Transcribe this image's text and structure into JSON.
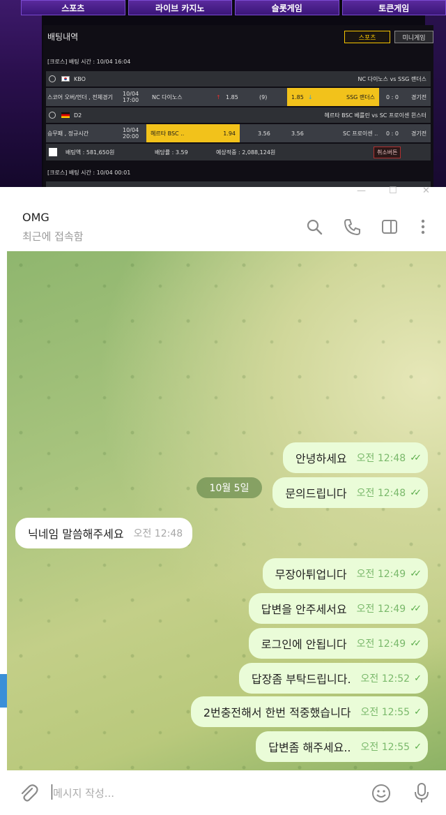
{
  "bet_site": {
    "nav_tabs": [
      "스포츠",
      "라이브 카지노",
      "슬롯게임",
      "토큰게임"
    ],
    "panel_title": "배팅내역",
    "filters": {
      "sports": "스포츠",
      "mini": "미니게임"
    },
    "bet1": {
      "time_label": "[크로스] 배팅 시간 : 10/04 16:04",
      "game1": {
        "league": "KBO",
        "matchup": "NC 다이노스 vs SSG 랜더스",
        "bet_type": "스코어 오버/언더 , 전체경기",
        "date": "10/04",
        "time": "17:00",
        "home": "NC 다이노스",
        "home_odds": "1.85",
        "line": "(9)",
        "away_odds": "1.85",
        "away": "SSG 랜더스",
        "score": "0 : 0",
        "status": "경기전"
      },
      "game2": {
        "league": "D2",
        "matchup": "헤르타 BSC 베를린 vs SC 프로이센 뮌스터",
        "bet_type": "승무패 , 정규시간",
        "date": "10/04",
        "time": "20:00",
        "home": "헤르타 BSC ..",
        "home_odds": "1.94",
        "draw_odds": "3.56",
        "away_odds": "3.56",
        "away": "SC 프로이센 ..",
        "score": "0 : 0",
        "status": "경기전"
      },
      "summary": {
        "amount": "배팅액 : 581,650원",
        "odds": "배당률 : 3.59",
        "expected": "예상적중 : 2,088,124원",
        "cancel": "취소버튼"
      }
    },
    "bet2": {
      "time_label": "[크로스] 배팅 시간 : 10/04 00:01"
    }
  },
  "telegram": {
    "window_controls": {
      "minimize": "—",
      "maximize": "☐",
      "close": "✕"
    },
    "chat_name": "OMG",
    "chat_status": "최근에 접속함",
    "date_pill": "10월 5일",
    "messages": [
      {
        "text": "안녕하세요",
        "time": "오전 12:48",
        "dir": "out",
        "read": true
      },
      {
        "text": "문의드립니다",
        "time": "오전 12:48",
        "dir": "out",
        "read": true
      },
      {
        "text": "닉네임 말씀해주세요",
        "time": "오전 12:48",
        "dir": "in"
      },
      {
        "text": "무장아튀업니다",
        "time": "오전 12:49",
        "dir": "out",
        "read": true
      },
      {
        "text": "답변을 안주세서요",
        "time": "오전 12:49",
        "dir": "out",
        "read": true
      },
      {
        "text": "로그인에 안됩니다",
        "time": "오전 12:49",
        "dir": "out",
        "read": true
      },
      {
        "text": "답장좀 부탁드립니다.",
        "time": "오전 12:52",
        "dir": "out",
        "read": false
      },
      {
        "text": "2번충전해서 한번 적중했습니다",
        "time": "오전 12:55",
        "dir": "out",
        "read": false
      },
      {
        "text": "답변좀 해주세요..",
        "time": "오전 12:55",
        "dir": "out",
        "read": false
      }
    ],
    "composer_placeholder": "메시지 작성..."
  }
}
